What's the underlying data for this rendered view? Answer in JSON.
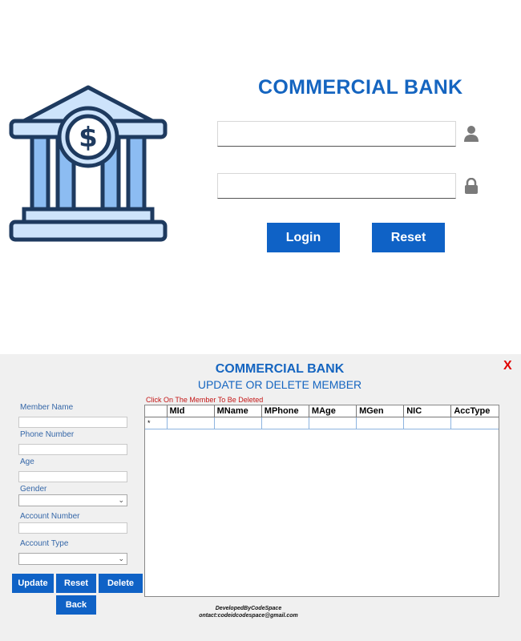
{
  "login": {
    "title": "COMMERCIAL BANK",
    "username_value": "",
    "password_value": "",
    "login_label": "Login",
    "reset_label": "Reset",
    "icons": {
      "logo": "bank-building-icon",
      "user": "user-icon",
      "lock": "lock-icon"
    }
  },
  "update": {
    "title": "COMMERCIAL BANK",
    "subtitle": "UPDATE OR DELETE MEMBER",
    "close": "X",
    "fields": {
      "member_name": "Member Name",
      "phone_number": "Phone Number",
      "age": "Age",
      "gender": "Gender",
      "account_number": "Account Number",
      "account_type": "Account Type"
    },
    "buttons": {
      "update": "Update",
      "reset": "Reset",
      "delete": "Delete",
      "back": "Back"
    },
    "hint": "Click On The Member To Be Deleted",
    "columns": [
      "MId",
      "MName",
      "MPhone",
      "MAge",
      "MGen",
      "NIC",
      "AccType"
    ],
    "new_row_marker": "*",
    "footer_line1": "DevelopedByCodeSpace",
    "footer_line2": "ontact:codeidcodespace@gmail.com"
  },
  "colors": {
    "accent": "#0f62c6",
    "title": "#1565c0",
    "close": "#e00000",
    "hint": "#c41616"
  }
}
